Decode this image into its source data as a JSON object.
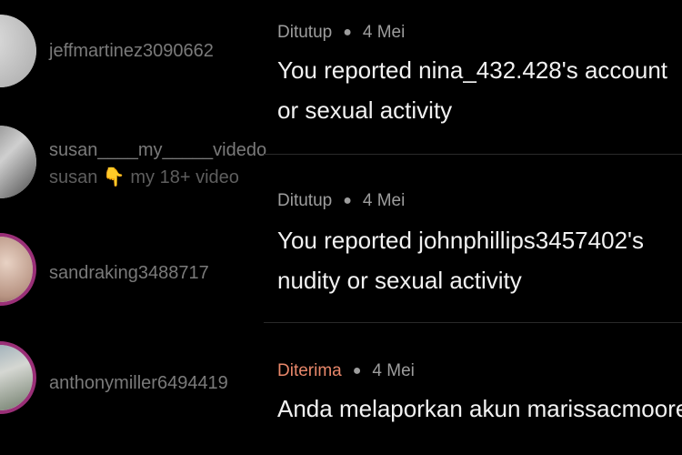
{
  "accounts": [
    {
      "username": "jeffmartinez3090662"
    },
    {
      "username": "susan____my_____videdo",
      "subtitle": "susan 👇 my 18+ video"
    },
    {
      "username": "sandraking3488717"
    },
    {
      "username": "anthonymiller6494419"
    }
  ],
  "reports": [
    {
      "status": "Ditutup",
      "date": "4 Mei",
      "line1": "You reported nina_432.428's account",
      "line2": "or sexual activity"
    },
    {
      "status": "Ditutup",
      "date": "4 Mei",
      "line1": "You reported johnphillips3457402's",
      "line2": "nudity or sexual activity"
    },
    {
      "status": "Diterima",
      "date": "4 Mei",
      "line1": "Anda melaporkan akun marissacmoore"
    }
  ],
  "colors": {
    "background": "#000000",
    "accepted_status": "#e8876a",
    "avatar_ring": "#9a2f77"
  }
}
